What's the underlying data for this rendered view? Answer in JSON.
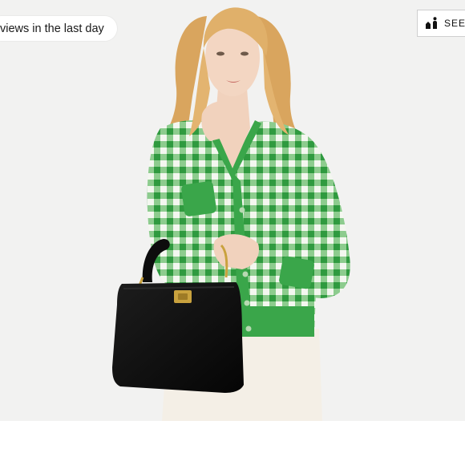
{
  "views_badge": {
    "text": "views in the last day"
  },
  "see_button": {
    "label": "SEE",
    "icon": "person-size-compare-icon"
  },
  "product_image": {
    "subject": "product-photo",
    "colors": {
      "background": "#f2f2f1",
      "cardigan": "#3aa64a",
      "bag": "#111111"
    }
  }
}
